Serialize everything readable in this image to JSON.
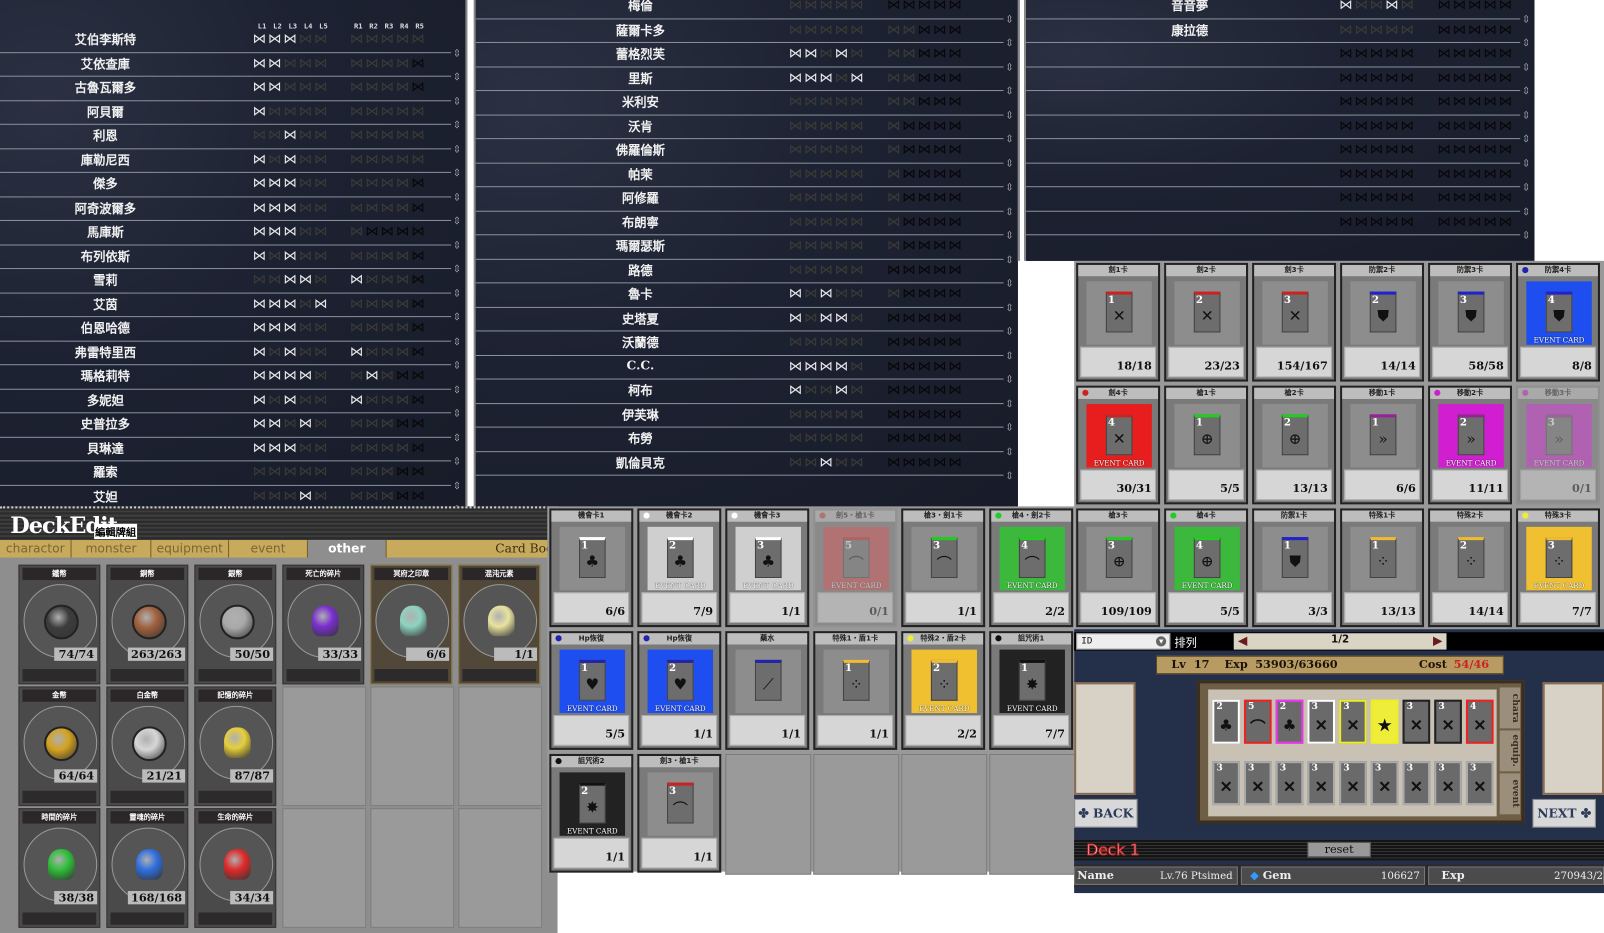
{
  "status_panel_1": {
    "headers_left": [
      "L1",
      "L2",
      "L3",
      "L4",
      "L5"
    ],
    "headers_right": [
      "R1",
      "R2",
      "R3",
      "R4",
      "R5"
    ],
    "rows": [
      {
        "name": "艾伯李斯特",
        "l": "11100",
        "r": "00000"
      },
      {
        "name": "艾依查庫",
        "l": "11000",
        "r": "00002"
      },
      {
        "name": "古魯瓦爾多",
        "l": "11000",
        "r": "00002"
      },
      {
        "name": "阿貝爾",
        "l": "10000",
        "r": "00000"
      },
      {
        "name": "利恩",
        "l": "00100",
        "r": "00000"
      },
      {
        "name": "庫勒尼西",
        "l": "10100",
        "r": "00000"
      },
      {
        "name": "傑多",
        "l": "11100",
        "r": "00002"
      },
      {
        "name": "阿奇波爾多",
        "l": "11100",
        "r": "00002"
      },
      {
        "name": "馬庫斯",
        "l": "11100",
        "r": "02222"
      },
      {
        "name": "布列依斯",
        "l": "10100",
        "r": "00002"
      },
      {
        "name": "雪莉",
        "l": "00110",
        "r": "10002"
      },
      {
        "name": "艾茵",
        "l": "11101",
        "r": "00002"
      },
      {
        "name": "伯恩哈德",
        "l": "11100",
        "r": "00002"
      },
      {
        "name": "弗雷特里西",
        "l": "10100",
        "r": "10002"
      },
      {
        "name": "瑪格莉特",
        "l": "11110",
        "r": "01022"
      },
      {
        "name": "多妮妲",
        "l": "10100",
        "r": "10002"
      },
      {
        "name": "史普拉多",
        "l": "11010",
        "r": "00022"
      },
      {
        "name": "貝琳達",
        "l": "11100",
        "r": "00002"
      },
      {
        "name": "羅索",
        "l": "00000",
        "r": "00022"
      },
      {
        "name": "艾妲",
        "l": "00010",
        "r": "00022"
      }
    ]
  },
  "status_panel_2": {
    "rows": [
      {
        "name": "梅倫",
        "l": "00000",
        "r": "22222"
      },
      {
        "name": "薩爾卡多",
        "l": "00000",
        "r": "00222"
      },
      {
        "name": "蕾格烈芙",
        "l": "11010",
        "r": "00222"
      },
      {
        "name": "里斯",
        "l": "11101",
        "r": "00222"
      },
      {
        "name": "米利安",
        "l": "00000",
        "r": "00222"
      },
      {
        "name": "沃肯",
        "l": "00000",
        "r": "02222"
      },
      {
        "name": "佛羅倫斯",
        "l": "00000",
        "r": "02222"
      },
      {
        "name": "帕茉",
        "l": "00000",
        "r": "02222"
      },
      {
        "name": "阿修羅",
        "l": "00000",
        "r": "02222"
      },
      {
        "name": "布朗寧",
        "l": "00000",
        "r": "02222"
      },
      {
        "name": "瑪爾瑟斯",
        "l": "00000",
        "r": "02222"
      },
      {
        "name": "路德",
        "l": "00000",
        "r": "22222"
      },
      {
        "name": "魯卡",
        "l": "10100",
        "r": "02222"
      },
      {
        "name": "史塔夏",
        "l": "10110",
        "r": "22222"
      },
      {
        "name": "沃蘭德",
        "l": "00000",
        "r": "22222"
      },
      {
        "name": "C.C.",
        "l": "11110",
        "r": "22222"
      },
      {
        "name": "柯布",
        "l": "10010",
        "r": "22222"
      },
      {
        "name": "伊芙琳",
        "l": "00000",
        "r": "22222"
      },
      {
        "name": "布勞",
        "l": "00000",
        "r": "22222"
      },
      {
        "name": "凱倫貝克",
        "l": "00100",
        "r": "22222"
      }
    ]
  },
  "status_panel_3": {
    "rows": [
      {
        "name": "音音夢",
        "l": "10010",
        "r": "22222"
      },
      {
        "name": "康拉德",
        "l": "00000",
        "r": "22222"
      },
      {
        "name": "",
        "l": "22222",
        "r": "22222"
      },
      {
        "name": "",
        "l": "22222",
        "r": "22222"
      },
      {
        "name": "",
        "l": "22222",
        "r": "22222"
      },
      {
        "name": "",
        "l": "22222",
        "r": "22222"
      },
      {
        "name": "",
        "l": "22222",
        "r": "22222"
      },
      {
        "name": "",
        "l": "22222",
        "r": "22222"
      },
      {
        "name": "",
        "l": "22222",
        "r": "22222"
      },
      {
        "name": "",
        "l": "22222",
        "r": "22222"
      }
    ]
  },
  "deck_edit": {
    "title": "DeckEdit",
    "subtitle": "編輯牌組",
    "tabs": [
      "charactor",
      "monster",
      "equipment",
      "event",
      "other"
    ],
    "active_tab": "other",
    "card_book": "Card Boo",
    "items": [
      {
        "title": "鐵幣",
        "count": "74/74",
        "kind": "coin",
        "color": "#3d3d3d"
      },
      {
        "title": "銅幣",
        "count": "263/263",
        "kind": "coin",
        "color": "#a0603c"
      },
      {
        "title": "銀幣",
        "count": "50/50",
        "kind": "coin",
        "color": "#a9a9a9"
      },
      {
        "title": "死亡的碎片",
        "count": "33/33",
        "kind": "gem",
        "color": "#7a2fd0"
      },
      {
        "title": "冥府之印章",
        "count": "6/6",
        "kind": "gem",
        "color": "#8fd3c0",
        "gold": true
      },
      {
        "title": "混沌元素",
        "count": "1/1",
        "kind": "gem",
        "color": "#e9e3a0",
        "gold": true
      },
      {
        "title": "金幣",
        "count": "64/64",
        "kind": "coin",
        "color": "#d4a21e"
      },
      {
        "title": "白金幣",
        "count": "21/21",
        "kind": "coin",
        "color": "#d6d6d6"
      },
      {
        "title": "記憶的碎片",
        "count": "87/87",
        "kind": "gem",
        "color": "#e6cf3a"
      },
      {
        "title": "時間的碎片",
        "count": "38/38",
        "kind": "gem",
        "color": "#2fbf3a"
      },
      {
        "title": "靈魂的碎片",
        "count": "168/168",
        "kind": "gem",
        "color": "#2f6fe0"
      },
      {
        "title": "生命的碎片",
        "count": "34/34",
        "kind": "gem",
        "color": "#e02a2a"
      }
    ]
  },
  "event_label": "EVENT CARD",
  "card_grid_mid": [
    {
      "title": "機會卡1",
      "count": "6/6",
      "n": "1",
      "icon": "♣",
      "art": "#8d8d8d",
      "stripe": "#fff"
    },
    {
      "title": "機會卡2",
      "count": "7/9",
      "n": "2",
      "icon": "♣",
      "art": "#cfcfcf",
      "stripe": "#fff",
      "event": true,
      "dot": "#fff"
    },
    {
      "title": "機會卡3",
      "count": "1/1",
      "n": "3",
      "icon": "♣",
      "art": "#cfcfcf",
      "stripe": "#fff",
      "event": true,
      "dot": "#fff"
    },
    {
      "title": "劍5・槍1卡",
      "count": "0/1",
      "n": "5",
      "icon": "⌒",
      "art": "#c44",
      "stripe": "#c22",
      "event": true,
      "faded": true,
      "dot": "#c44"
    },
    {
      "title": "槍3・劍1卡",
      "count": "1/1",
      "n": "3",
      "icon": "⌒",
      "art": "#8d8d8d",
      "stripe": "#2c2"
    },
    {
      "title": "槍4・劍2卡",
      "count": "2/2",
      "n": "4",
      "icon": "⌒",
      "art": "#3cb83c",
      "stripe": "#2c2",
      "event": true,
      "dot": "#2c2"
    },
    {
      "title": "Hp恢復",
      "count": "5/5",
      "n": "1",
      "icon": "♥",
      "art": "#1e4ef0",
      "stripe": "#22a",
      "event": true,
      "dot": "#22a"
    },
    {
      "title": "Hp恢復",
      "count": "1/1",
      "n": "2",
      "icon": "♥",
      "art": "#1e4ef0",
      "stripe": "#22a",
      "event": true,
      "dot": "#22a"
    },
    {
      "title": "藥水",
      "count": "1/1",
      "n": "",
      "icon": "⟋",
      "art": "#8d8d8d",
      "stripe": "#22a"
    },
    {
      "title": "特殊1・盾1卡",
      "count": "1/1",
      "n": "1",
      "icon": "⁘",
      "art": "#8d8d8d",
      "stripe": "#eb3"
    },
    {
      "title": "特殊2・盾2卡",
      "count": "2/2",
      "n": "2",
      "icon": "⁘",
      "art": "#f0c030",
      "stripe": "#eb3",
      "event": true,
      "dot": "#ee3"
    },
    {
      "title": "詛咒術1",
      "count": "7/7",
      "n": "1",
      "icon": "✸",
      "art": "#222",
      "stripe": "#111",
      "event": true,
      "dot": "#111"
    },
    {
      "title": "詛咒術2",
      "count": "1/1",
      "n": "2",
      "icon": "✸",
      "art": "#222",
      "stripe": "#111",
      "event": true,
      "dot": "#111"
    },
    {
      "title": "劍3・槍1卡",
      "count": "1/1",
      "n": "3",
      "icon": "⌒",
      "art": "#8d8d8d",
      "stripe": "#c22"
    }
  ],
  "card_grid_right": [
    {
      "title": "劍1卡",
      "count": "18/18",
      "n": "1",
      "icon": "✕",
      "art": "#8d8d8d",
      "stripe": "#c22"
    },
    {
      "title": "劍2卡",
      "count": "23/23",
      "n": "2",
      "icon": "✕",
      "art": "#8d8d8d",
      "stripe": "#c22"
    },
    {
      "title": "劍3卡",
      "count": "154/167",
      "n": "3",
      "icon": "✕",
      "art": "#8d8d8d",
      "stripe": "#c22"
    },
    {
      "title": "防禦2卡",
      "count": "14/14",
      "n": "2",
      "icon": "⛊",
      "art": "#8d8d8d",
      "stripe": "#22c"
    },
    {
      "title": "防禦3卡",
      "count": "58/58",
      "n": "3",
      "icon": "⛊",
      "art": "#8d8d8d",
      "stripe": "#22c"
    },
    {
      "title": "防禦4卡",
      "count": "8/8",
      "n": "4",
      "icon": "⛊",
      "art": "#1e4ef0",
      "stripe": "#22c",
      "event": true,
      "dot": "#22a"
    },
    {
      "title": "劍4卡",
      "count": "30/31",
      "n": "4",
      "icon": "✕",
      "art": "#e81e1e",
      "stripe": "#c22",
      "event": true,
      "dot": "#c22"
    },
    {
      "title": "槍1卡",
      "count": "5/5",
      "n": "1",
      "icon": "⊕",
      "art": "#8d8d8d",
      "stripe": "#2c2"
    },
    {
      "title": "槍2卡",
      "count": "13/13",
      "n": "2",
      "icon": "⊕",
      "art": "#8d8d8d",
      "stripe": "#2c2"
    },
    {
      "title": "移動1卡",
      "count": "6/6",
      "n": "1",
      "icon": "»",
      "art": "#8d8d8d",
      "stripe": "#929"
    },
    {
      "title": "移動2卡",
      "count": "11/11",
      "n": "2",
      "icon": "»",
      "art": "#d01ed0",
      "stripe": "#929",
      "event": true,
      "dot": "#c2c"
    },
    {
      "title": "移動3卡",
      "count": "0/1",
      "n": "3",
      "icon": "»",
      "art": "#d01ed0",
      "stripe": "#929",
      "event": true,
      "faded": true,
      "dot": "#c2c"
    },
    {
      "title": "槍3卡",
      "count": "109/109",
      "n": "3",
      "icon": "⊕",
      "art": "#8d8d8d",
      "stripe": "#2c2"
    },
    {
      "title": "槍4卡",
      "count": "5/5",
      "n": "4",
      "icon": "⊕",
      "art": "#3cb83c",
      "stripe": "#2c2",
      "event": true,
      "dot": "#2c2"
    },
    {
      "title": "防禦1卡",
      "count": "3/3",
      "n": "1",
      "icon": "⛊",
      "art": "#8d8d8d",
      "stripe": "#22c"
    },
    {
      "title": "特殊1卡",
      "count": "13/13",
      "n": "1",
      "icon": "⁘",
      "art": "#8d8d8d",
      "stripe": "#eb3"
    },
    {
      "title": "特殊2卡",
      "count": "14/14",
      "n": "2",
      "icon": "⁘",
      "art": "#8d8d8d",
      "stripe": "#eb3"
    },
    {
      "title": "特殊3卡",
      "count": "7/7",
      "n": "3",
      "icon": "⁘",
      "art": "#f0c030",
      "stripe": "#eb3",
      "event": true,
      "dot": "#ee3"
    }
  ],
  "deck": {
    "sort_value": "ID",
    "sort_label": "排列",
    "page": "1/2",
    "lv_label": "Lv",
    "lv": "17",
    "exp_label": "Exp",
    "exp": "53903/63660",
    "cost_label": "Cost",
    "cost": "54/46",
    "top_slots": [
      {
        "n": "2",
        "icon": "♣",
        "border": "#fff"
      },
      {
        "n": "5",
        "icon": "⌒",
        "border": "#e22"
      },
      {
        "n": "2",
        "icon": "♣",
        "border": "#e3e"
      },
      {
        "n": "3",
        "icon": "✕",
        "border": "#fff"
      },
      {
        "n": "3",
        "icon": "✕",
        "border": "#ee2"
      },
      {
        "n": "",
        "icon": "★",
        "border": "#ee2",
        "fill": "#eded3a"
      },
      {
        "n": "3",
        "icon": "✕",
        "border": "#222"
      },
      {
        "n": "3",
        "icon": "✕",
        "border": "#222"
      },
      {
        "n": "4",
        "icon": "✕",
        "border": "#e22"
      }
    ],
    "bottom_slots": [
      "3",
      "3",
      "3",
      "3",
      "3",
      "3",
      "3",
      "3",
      "3"
    ],
    "side_tabs": [
      "chara",
      "equip.",
      "event"
    ],
    "back": "BACK",
    "next": "NEXT",
    "deck_name": "Deck 1",
    "reset": "reset",
    "name_label": "Name",
    "player": "Lv.76 Ptsimed",
    "gem_label": "Gem",
    "gem": "106627",
    "exp2_label": "Exp",
    "exp2": "270943/2"
  }
}
